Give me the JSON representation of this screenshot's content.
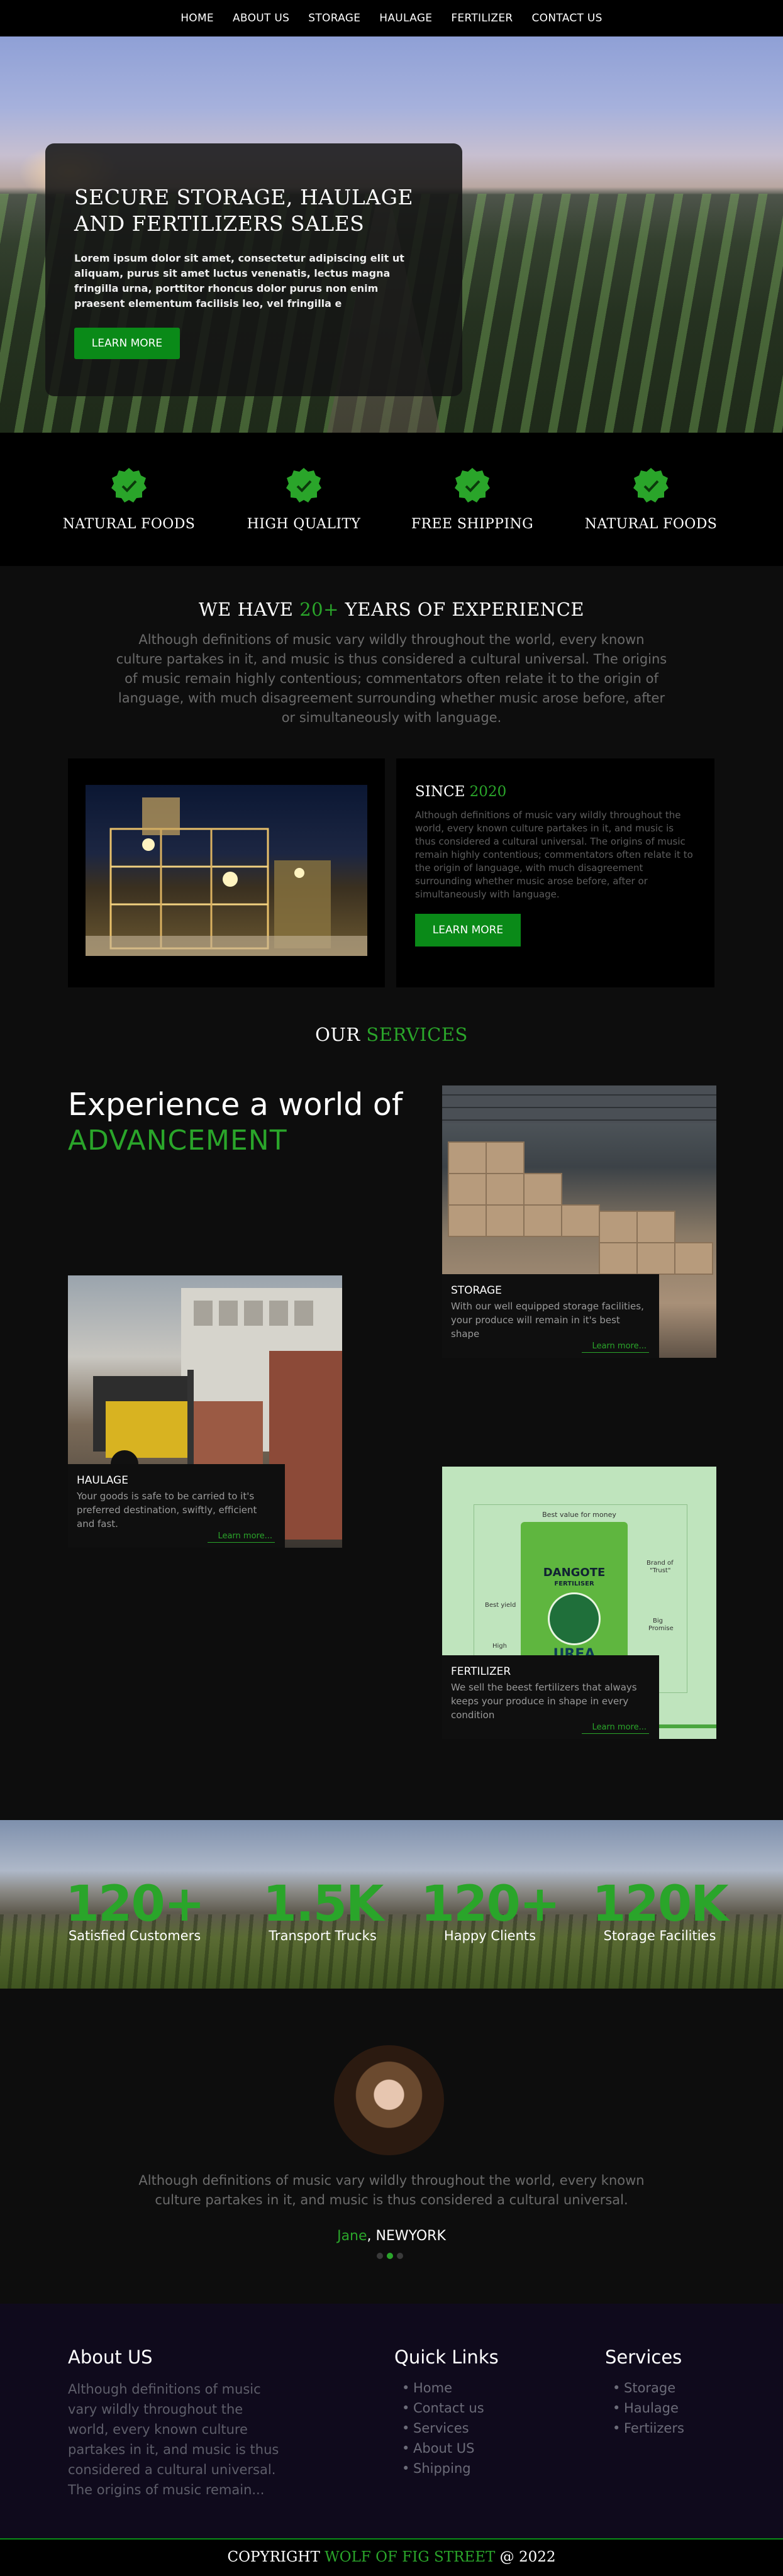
{
  "nav": {
    "items": [
      "HOME",
      "ABOUT US",
      "STORAGE",
      "HAULAGE",
      "FERTILIZER",
      "CONTACT US"
    ]
  },
  "hero": {
    "title_line1": "SECURE STORAGE, HAULAGE",
    "title_line2": "AND FERTILIZERS SALES",
    "text": "Lorem ipsum dolor sit amet, consectetur adipiscing elit ut aliquam, purus sit amet luctus venenatis, lectus magna fringilla urna, porttitor rhoncus dolor purus non enim praesent elementum facilisis leo, vel fringilla e",
    "button": "LEARN MORE"
  },
  "features": [
    {
      "label": "NATURAL FOODS",
      "icon": "check-badge-icon"
    },
    {
      "label": "HIGH QUALITY",
      "icon": "check-badge-icon"
    },
    {
      "label": "FREE SHIPPING",
      "icon": "check-badge-icon"
    },
    {
      "label": "NATURAL FOODS",
      "icon": "check-badge-icon"
    }
  ],
  "experience": {
    "title_pre": "WE HAVE ",
    "title_highlight": "20+",
    "title_post": " YEARS OF EXPERIENCE",
    "text": "Although definitions of music vary wildly throughout the world, every known culture partakes in it, and music is thus considered a cultural universal. The origins of music remain highly contentious; commentators often relate it to the origin of language, with much disagreement surrounding whether music arose before, after or simultaneously with language."
  },
  "since": {
    "title_pre": "SINCE ",
    "title_year": "2020",
    "text": "Although definitions of music vary wildly throughout the world, every known culture partakes in it, and music is thus considered a cultural universal. The origins of music remain highly contentious; commentators often relate it to the origin of language, with much disagreement surrounding whether music arose before, after or simultaneously with language.",
    "button": "LEARN MORE"
  },
  "services": {
    "title_pre": "OUR ",
    "title_highlight": "SERVICES",
    "headline_1": "Experience a world of",
    "headline_2": "ADVANCEMENT",
    "cards": [
      {
        "title": "STORAGE",
        "text": "With our well equipped storage facilities, your produce will remain in it's best shape",
        "more": "Learn more..."
      },
      {
        "title": "HAULAGE",
        "text": "Your goods is safe to be carried to it's preferred destination, swiftly, efficient and fast.",
        "more": "Learn more..."
      },
      {
        "title": "FERTILIZER",
        "text": "We sell the beest fertilizers that always keeps your produce in shape in every condition",
        "more": "Learn more..."
      }
    ],
    "fert_image": {
      "top": "Best value for money",
      "brand": "DANGOTE",
      "sub": "FERTILISER",
      "product": "UREA",
      "left1": "Best yield",
      "left2": "High",
      "right1": "Brand of",
      "right1b": "\"Trust\"",
      "right2": "Big",
      "right2b": "Promise"
    }
  },
  "stats": [
    {
      "value": "120+",
      "label": "Satisfied Customers"
    },
    {
      "value": "1.5K",
      "label": "Transport Trucks"
    },
    {
      "value": "120+",
      "label": "Happy Clients"
    },
    {
      "value": "120K",
      "label": "Storage Facilities"
    }
  ],
  "testimonial": {
    "text": "Although definitions of music vary wildly throughout the world, every known culture partakes in it, and music is thus considered a cultural universal.",
    "name": "Jane",
    "location": ", NEWYORK"
  },
  "footer": {
    "about_title": "About US",
    "about_text": "Although definitions of music vary wildly throughout the world, every known culture partakes in it, and music is thus considered a cultural universal. The origins of music remain...",
    "quick_title": "Quick Links",
    "quick_links": [
      "Home",
      "Contact us",
      "Services",
      "About US",
      "Shipping"
    ],
    "services_title": "Services",
    "services_links": [
      "Storage",
      "Haulage",
      "Fertiizers"
    ],
    "copy_pre": "COPYRIGHT ",
    "copy_brand": "WOLF OF FIG STREET",
    "copy_post": " @ 2022"
  },
  "colors": {
    "accent": "#2aa52a",
    "button": "#0a8a18",
    "background": "#0d0d0d",
    "footer": "#0f0a1c"
  }
}
